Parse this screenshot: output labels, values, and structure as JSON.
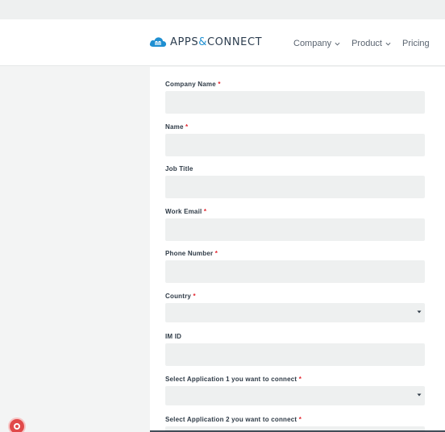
{
  "brand": {
    "name_left": "APPS",
    "name_amp": "&",
    "name_right": "CONNECT"
  },
  "nav": [
    {
      "label": "Company"
    },
    {
      "label": "Product"
    },
    {
      "label": "Pricing"
    }
  ],
  "form": {
    "required_mark": "*",
    "fields": [
      {
        "label": "Company Name",
        "required": true
      },
      {
        "label": "Name",
        "required": true
      },
      {
        "label": "Job Title",
        "required": false
      },
      {
        "label": "Work Email",
        "required": true
      },
      {
        "label": "Phone Number",
        "required": true
      },
      {
        "label": "Country",
        "required": true,
        "type": "select"
      },
      {
        "label": "IM ID",
        "required": false
      },
      {
        "label": "Select Application 1 you want to connect",
        "required": true,
        "type": "select"
      },
      {
        "label": "Select Application 2 you want to connect",
        "required": true,
        "type": "select"
      }
    ]
  },
  "colors": {
    "accent": "#1f8fd1",
    "required": "#e3262f",
    "input_bg": "#eef0f0"
  }
}
